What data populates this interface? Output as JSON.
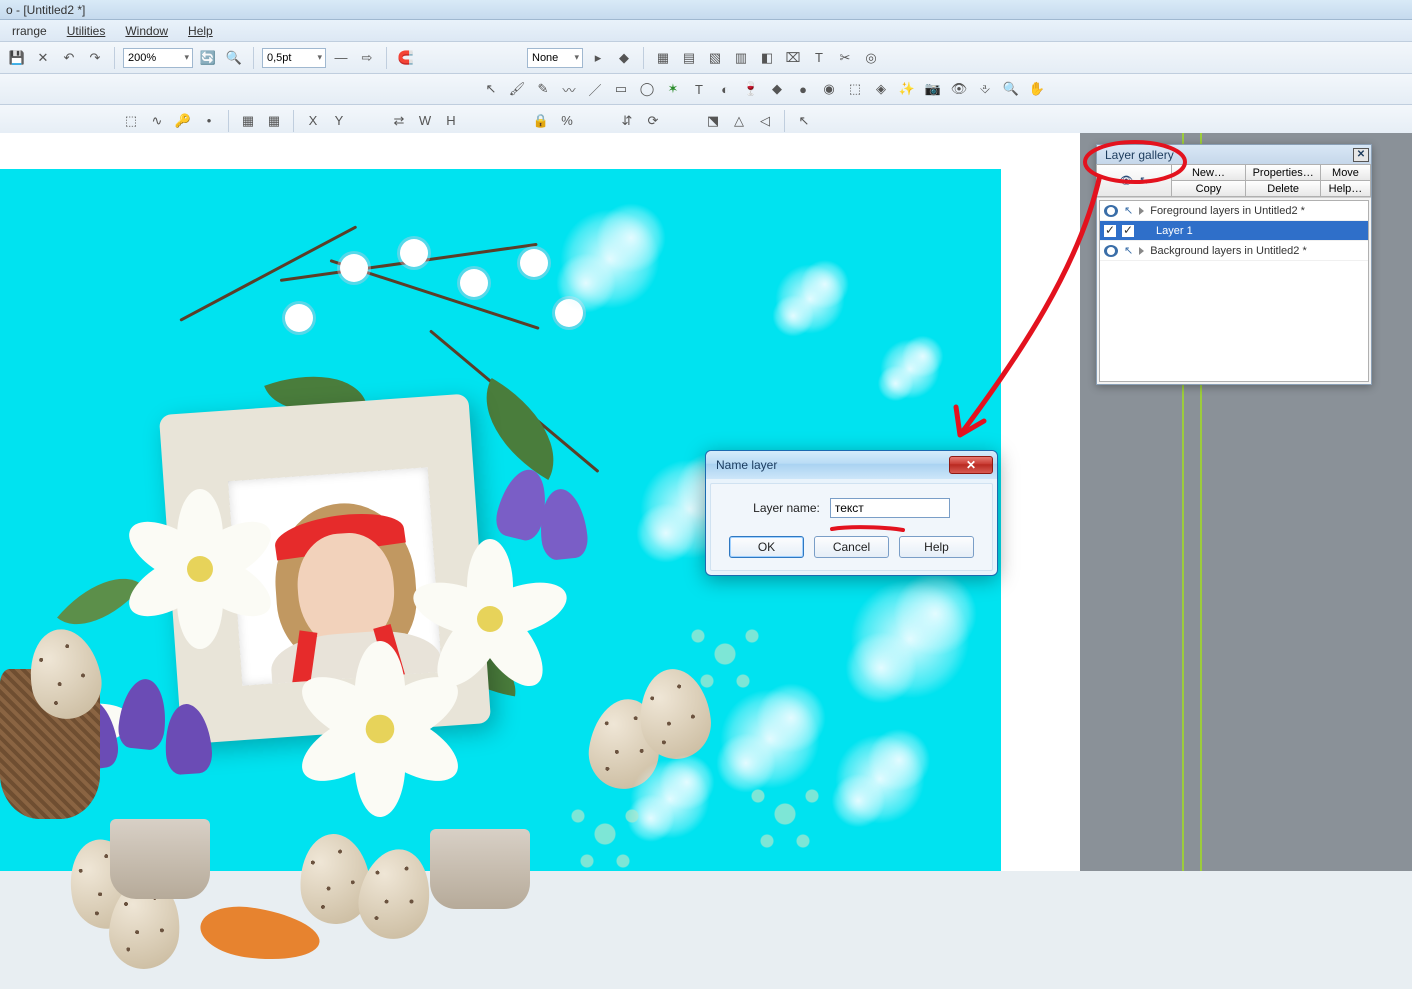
{
  "title": "o - [Untitled2 *]",
  "menus": {
    "arrange": "rrange",
    "utilities": "Utilities",
    "window": "Window",
    "help": "Help"
  },
  "toolbar1": {
    "zoom": "200%",
    "stroke": "0,5pt",
    "none_combo": "None"
  },
  "dialog": {
    "title": "Name layer",
    "label": "Layer name:",
    "value": "текст",
    "ok": "OK",
    "cancel": "Cancel",
    "help": "Help"
  },
  "panel": {
    "title": "Layer gallery",
    "buttons": {
      "new": "New…",
      "properties": "Properties…",
      "move": "Move",
      "copy": "Copy",
      "delete": "Delete",
      "help": "Help…"
    },
    "layers": [
      {
        "name": "Foreground layers in Untitled2 *",
        "group": true,
        "selected": false
      },
      {
        "name": "Layer 1",
        "group": false,
        "selected": true,
        "checked": true
      },
      {
        "name": "Background layers in Untitled2 *",
        "group": true,
        "selected": false
      }
    ]
  }
}
